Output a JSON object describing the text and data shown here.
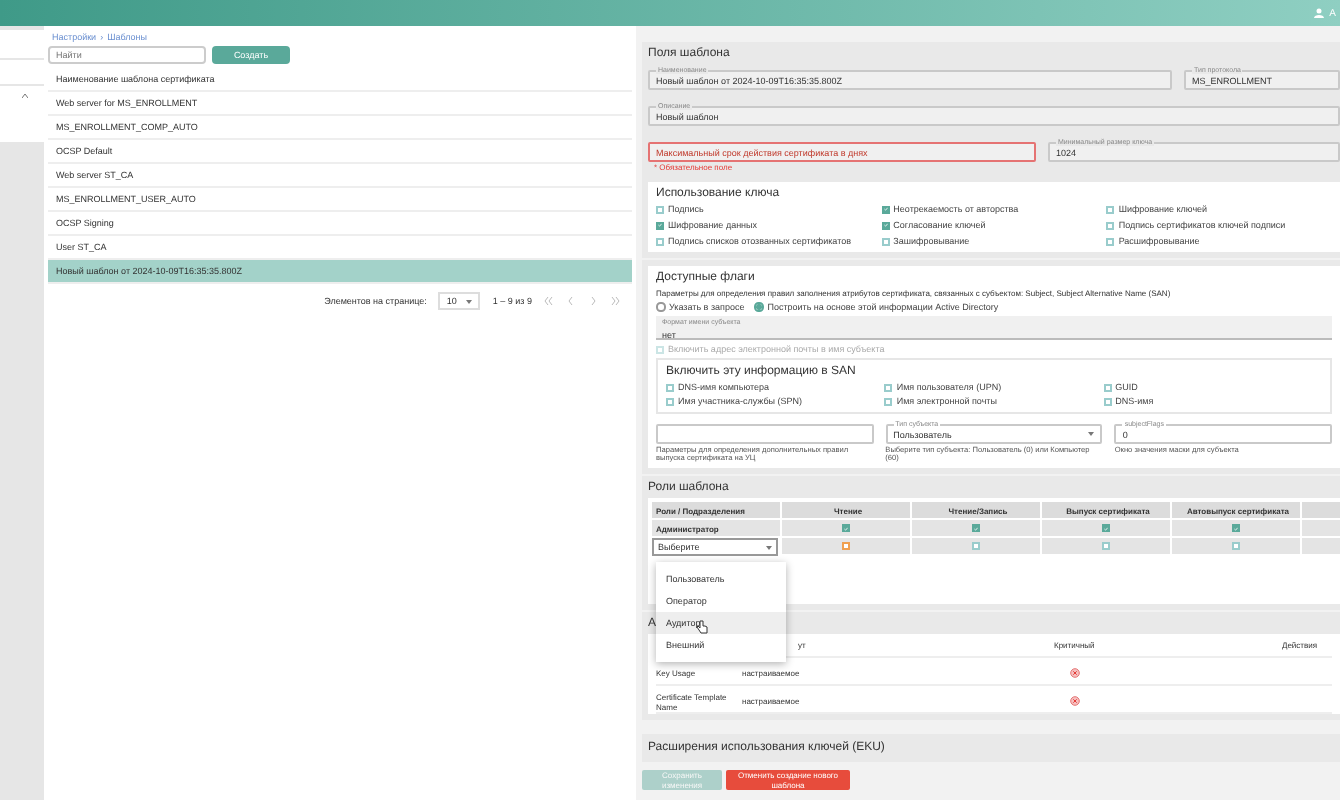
{
  "header": {
    "user": "А"
  },
  "breadcrumb": {
    "items": [
      "Настройки",
      "Шаблоны"
    ],
    "separator": "›"
  },
  "search": {
    "placeholder": "Найти"
  },
  "create_button": "Создать",
  "templates": {
    "column": "Наименование шаблона сертификата",
    "rows": [
      {
        "name": "Web server for MS_ENROLLMENT",
        "selected": false
      },
      {
        "name": "MS_ENROLLMENT_COMP_AUTO",
        "selected": false
      },
      {
        "name": "OCSP Default",
        "selected": false
      },
      {
        "name": "Web server ST_CA",
        "selected": false
      },
      {
        "name": "MS_ENROLLMENT_USER_AUTO",
        "selected": false
      },
      {
        "name": "OCSP Signing",
        "selected": false
      },
      {
        "name": "User ST_CA",
        "selected": false
      },
      {
        "name": "Новый шаблон от 2024-10-09T16:35:35.800Z",
        "selected": true
      }
    ]
  },
  "pagination": {
    "label": "Элементов на странице:",
    "page_size": "10",
    "range": "1 – 9 из 9"
  },
  "fields": {
    "title": "Поля шаблона",
    "name": {
      "label": "Наименование",
      "value": "Новый шаблон от 2024-10-09T16:35:35.800Z"
    },
    "protocol": {
      "label": "Тип протокола",
      "value": "MS_ENROLLMENT"
    },
    "description": {
      "label": "Описание",
      "value": "Новый шаблон"
    },
    "validity": {
      "placeholder": "Максимальный срок действия сертификата в днях",
      "error": "* Обязательное поле"
    },
    "key_size": {
      "label": "Минимальный размер ключа",
      "value": "1024"
    }
  },
  "key_usage": {
    "title": "Использование ключа",
    "columns": [
      [
        {
          "label": "Подпись",
          "checked": false
        },
        {
          "label": "Шифрование данных",
          "checked": true
        },
        {
          "label": "Подпись списков отозванных сертификатов",
          "checked": false
        }
      ],
      [
        {
          "label": "Неотрекаемость от авторства",
          "checked": true
        },
        {
          "label": "Согласование ключей",
          "checked": true
        },
        {
          "label": "Зашифровывание",
          "checked": false
        }
      ],
      [
        {
          "label": "Шифрование ключей",
          "checked": false
        },
        {
          "label": "Подпись сертификатов ключей подписи",
          "checked": false
        },
        {
          "label": "Расшифровывание",
          "checked": false
        }
      ]
    ]
  },
  "flags": {
    "title": "Доступные флаги",
    "description": "Параметры для определения правил заполнения атрибутов сертификата, связанных с субъектом: Subject, Subject Alternative Name (SAN)",
    "radios": [
      {
        "label": "Указать в запросе",
        "selected": false
      },
      {
        "label": "Построить на основе этой информации Active Directory",
        "selected": true
      }
    ],
    "subject_format": {
      "label": "Формат имени субъекта",
      "value": "нет"
    },
    "email_in_subject": {
      "label": "Включить адрес электронной почты в имя субъекта",
      "checked": false,
      "disabled": true
    },
    "san": {
      "title": "Включить эту информацию в SAN",
      "columns": [
        [
          {
            "label": "DNS-имя компьютера",
            "checked": false
          },
          {
            "label": "Имя участника-службы (SPN)",
            "checked": false
          }
        ],
        [
          {
            "label": "Имя пользователя (UPN)",
            "checked": false
          },
          {
            "label": "Имя электронной почты",
            "checked": false
          }
        ],
        [
          {
            "label": "GUID",
            "checked": false
          },
          {
            "label": "DNS-имя",
            "checked": false
          }
        ]
      ]
    },
    "extra": [
      {
        "kind": "input",
        "hint": "Параметры для определения дополнительных правил выпуска сертификата на УЦ"
      },
      {
        "kind": "select",
        "label": "Тип субъекта",
        "value": "Пользователь",
        "hint": "Выберите тип субъекта: Пользователь (0) или Компьютер (60)"
      },
      {
        "kind": "input",
        "label": "subjectFlags",
        "value": "0",
        "hint": "Окно значения маски для субъекта"
      }
    ]
  },
  "roles": {
    "title": "Роли шаблона",
    "columns": [
      "Роли / Подразделения",
      "Чтение",
      "Чтение/Запись",
      "Выпуск сертификата",
      "Автовыпуск сертификата"
    ],
    "rows": [
      {
        "kind": "role",
        "name": "Администратор",
        "cells": [
          {
            "checked": true,
            "highlighted": false
          },
          {
            "checked": true,
            "highlighted": false
          },
          {
            "checked": true,
            "highlighted": false
          },
          {
            "checked": true,
            "highlighted": false
          }
        ]
      },
      {
        "kind": "select",
        "placeholder": "Выберите",
        "cells": [
          {
            "checked": false,
            "highlighted": true
          },
          {
            "checked": false,
            "highlighted": false
          },
          {
            "checked": false,
            "highlighted": false
          },
          {
            "checked": false,
            "highlighted": false
          }
        ]
      }
    ],
    "menu": [
      {
        "label": "Пользователь",
        "hovered": false
      },
      {
        "label": "Оператор",
        "hovered": false
      },
      {
        "label": "Аудитор",
        "hovered": true
      },
      {
        "label": "Внешний",
        "hovered": false
      }
    ]
  },
  "attributes": {
    "title": "А",
    "columns": [
      "ут",
      "Критичный",
      "Действия"
    ],
    "rows": [
      {
        "name": "Key Usage",
        "value": "настраиваемое",
        "critical": true
      },
      {
        "name": "Certificate Template Name",
        "value": "настраиваемое",
        "critical": true
      }
    ]
  },
  "eku": {
    "title": "Расширения использования ключей (EKU)"
  },
  "actions": [
    {
      "label": "Сохранить изменения",
      "kind": "primary",
      "disabled": true
    },
    {
      "label": "Отменить создание нового шаблона",
      "kind": "danger",
      "disabled": false
    }
  ]
}
